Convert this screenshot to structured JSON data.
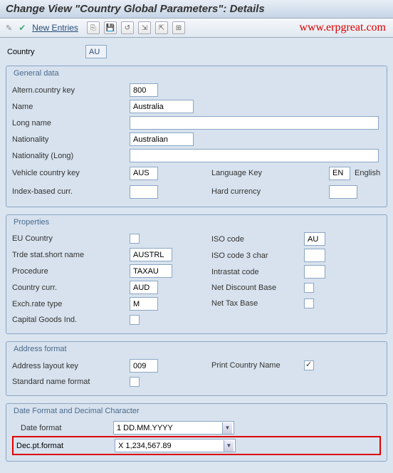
{
  "title": "Change View \"Country Global Parameters\": Details",
  "toolbar": {
    "new_entries_label": "New Entries",
    "watermark": "www.erpgreat.com"
  },
  "top": {
    "country_label": "Country",
    "country_value": "AU"
  },
  "general": {
    "title": "General data",
    "altern_key_label": "Altern.country key",
    "altern_key_value": "800",
    "name_label": "Name",
    "name_value": "Australia",
    "long_name_label": "Long name",
    "long_name_value": "",
    "nationality_label": "Nationality",
    "nationality_value": "Australian",
    "nationality_long_label": "Nationality (Long)",
    "nationality_long_value": "",
    "vehicle_key_label": "Vehicle country key",
    "vehicle_key_value": "AUS",
    "language_key_label": "Language Key",
    "language_key_value": "EN",
    "language_name": "English",
    "index_curr_label": "Index-based curr.",
    "index_curr_value": "",
    "hard_curr_label": "Hard currency",
    "hard_curr_value": ""
  },
  "properties": {
    "title": "Properties",
    "eu_country_label": "EU Country",
    "trde_stat_label": "Trde stat.short name",
    "trde_stat_value": "AUSTRL",
    "procedure_label": "Procedure",
    "procedure_value": "TAXAU",
    "country_curr_label": "Country curr.",
    "country_curr_value": "AUD",
    "exch_rate_label": "Exch.rate type",
    "exch_rate_value": "M",
    "capital_goods_label": "Capital Goods Ind.",
    "iso_label": "ISO code",
    "iso_value": "AU",
    "iso3_label": "ISO code 3 char",
    "iso3_value": "",
    "intrastat_label": "Intrastat code",
    "intrastat_value": "",
    "net_discount_label": "Net Discount Base",
    "net_tax_label": "Net Tax Base"
  },
  "address": {
    "title": "Address format",
    "layout_key_label": "Address layout key",
    "layout_key_value": "009",
    "print_country_label": "Print Country Name",
    "std_name_label": "Standard name format"
  },
  "date_format": {
    "title": "Date Format and Decimal Character",
    "date_label": "Date format",
    "date_value": "1 DD.MM.YYYY",
    "dec_label": "Dec.pt.format",
    "dec_value": "X 1,234,567.89"
  }
}
